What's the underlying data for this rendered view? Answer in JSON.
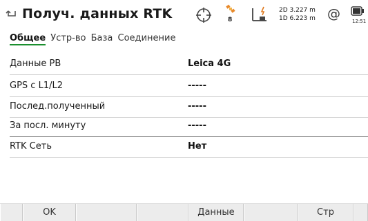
{
  "header": {
    "title": "Получ. данных RTK",
    "satellites": "8",
    "accuracy_2d": "2D 3.227 m",
    "accuracy_1d": "1D 6.223 m",
    "at_symbol": "@",
    "time": "12:51",
    "icons": [
      "back-arrow-icon",
      "crosshair-icon",
      "satellite-icon",
      "rover-pole-icon",
      "battery-icon"
    ]
  },
  "tabs": [
    {
      "label": "Общее",
      "active": true
    },
    {
      "label": "Устр-во",
      "active": false
    },
    {
      "label": "База",
      "active": false
    },
    {
      "label": "Соединение",
      "active": false
    }
  ],
  "rows": [
    {
      "label": "Данные РВ",
      "value": "Leica 4G"
    },
    {
      "label": "GPS с L1/L2",
      "value": "-----"
    },
    {
      "label": "Послед.полученный",
      "value": "-----"
    },
    {
      "label": "За посл. минуту",
      "value": "-----"
    },
    {
      "label": "RTK Сеть",
      "value": "Нет"
    }
  ],
  "footer": {
    "ok": "OK",
    "data": "Данные",
    "page": "Стр"
  },
  "colors": {
    "accent": "#1a8f2e",
    "satellite_orange": "#e8892b",
    "pole_orange": "#e07a1e"
  }
}
